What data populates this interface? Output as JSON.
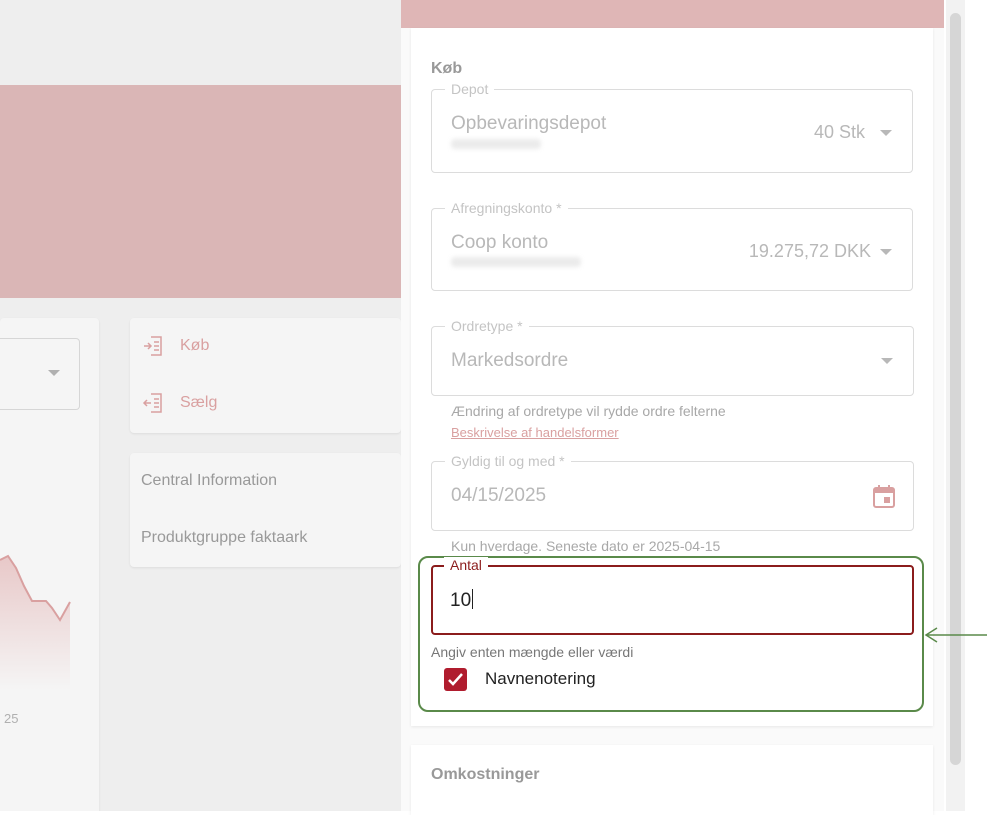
{
  "background": {
    "chart_tick": "25",
    "actions": [
      {
        "label": "Køb",
        "icon": "buy-icon"
      },
      {
        "label": "Sælg",
        "icon": "sell-icon"
      }
    ],
    "info_items": [
      "Central Information",
      "Produktgruppe faktaark"
    ]
  },
  "order_panel": {
    "section_title": "Køb",
    "depot": {
      "label": "Depot",
      "value": "Opbevaringsdepot",
      "quantity": "40 Stk"
    },
    "account": {
      "label": "Afregningskonto *",
      "value": "Coop konto",
      "balance": "19.275,72 DKK"
    },
    "order_type": {
      "label": "Ordretype *",
      "value": "Markedsordre",
      "helper": "Ændring af ordretype vil rydde ordre felterne",
      "link": "Beskrivelse af handelsformer"
    },
    "valid_until": {
      "label": "Gyldig til og med *",
      "value": "04/15/2025",
      "helper": "Kun hverdage. Seneste dato er 2025-04-15"
    },
    "quantity": {
      "label": "Antal",
      "value": "10",
      "helper": "Angiv enten mængde eller værdi"
    },
    "name_notation": {
      "label": "Navnenotering",
      "checked": true
    },
    "costs_title": "Omkostninger"
  },
  "colors": {
    "accent": "#b01c2e",
    "error_border": "#8b1c1c",
    "highlight": "#5a8a4a",
    "hero": "#dab6b6"
  }
}
